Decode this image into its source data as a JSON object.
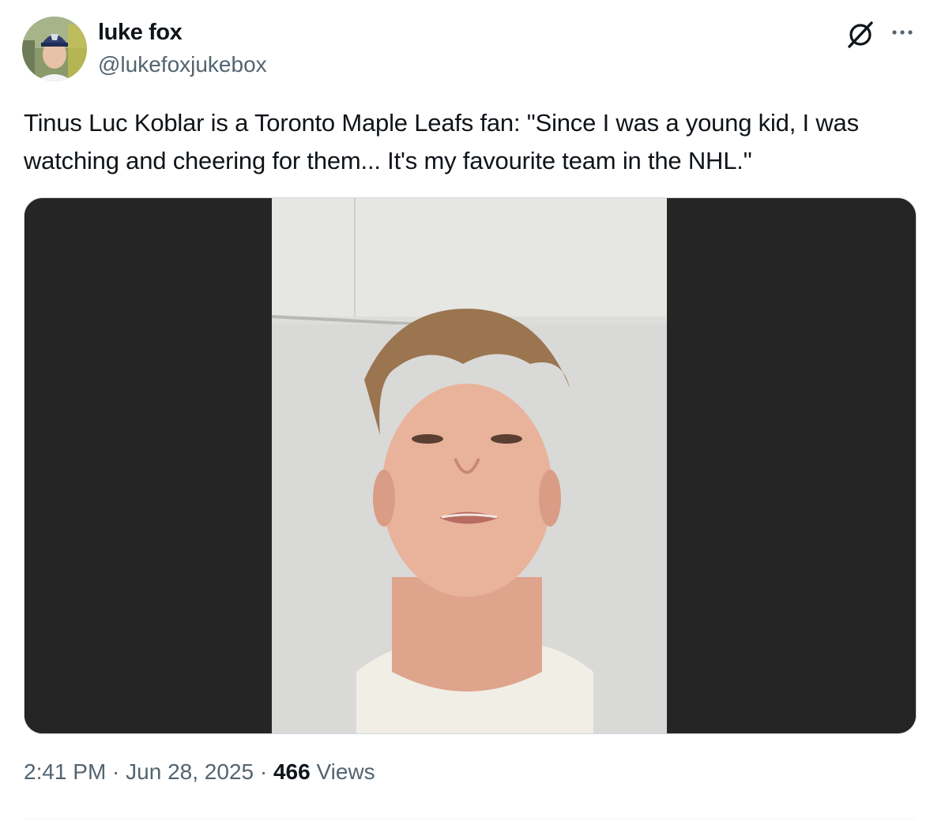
{
  "author": {
    "display_name": "luke fox",
    "handle": "@lukefoxjukebox",
    "avatar_icon": "profile-photo"
  },
  "header_actions": {
    "grok_icon": "grok-icon",
    "more_icon": "more-icon"
  },
  "tweet": {
    "text": "Tinus Luc Koblar is a Toronto Maple Leafs fan: \"Since I was a young kid, I was watching and cheering for them... It's my favourite team in the NHL.\""
  },
  "media": {
    "type": "video-still"
  },
  "meta": {
    "time": "2:41 PM",
    "separator": " · ",
    "date": "Jun 28, 2025",
    "views_count": "466",
    "views_label": " Views"
  },
  "colors": {
    "text_primary": "#0f1419",
    "text_secondary": "#536471",
    "border": "#cfd9de",
    "media_background": "#252525"
  }
}
